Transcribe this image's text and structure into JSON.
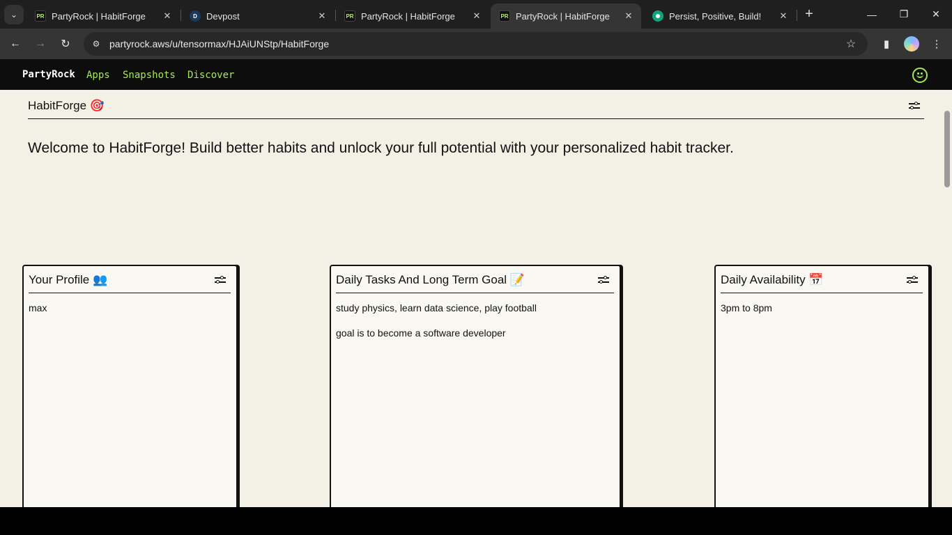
{
  "browser": {
    "tabs": [
      {
        "title": "PartyRock | HabitForge",
        "favicon": "PR",
        "active": false
      },
      {
        "title": "Devpost",
        "favicon": "D",
        "active": false
      },
      {
        "title": "PartyRock | HabitForge",
        "favicon": "PR",
        "active": false
      },
      {
        "title": "PartyRock | HabitForge",
        "favicon": "PR",
        "active": true
      },
      {
        "title": "Persist, Positive, Build!",
        "favicon": "",
        "active": false
      }
    ],
    "url": "partyrock.aws/u/tensormax/HJAiUNStp/HabitForge"
  },
  "app_nav": {
    "brand": "PartyRock",
    "links": [
      "Apps",
      "Snapshots",
      "Discover"
    ],
    "accent_color": "#a6e65a"
  },
  "app": {
    "title": "HabitForge 🎯",
    "welcome": "Welcome to HabitForge! Build better habits and unlock your full potential with your personalized habit tracker."
  },
  "widgets": [
    {
      "title": "Your Profile 👥",
      "lines": [
        "max"
      ]
    },
    {
      "title": "Daily Tasks And Long Term Goal 📝",
      "lines": [
        "study physics, learn data science, play football",
        "goal is to become a software developer"
      ]
    },
    {
      "title": "Daily Availability 📅",
      "lines": [
        "3pm to 8pm"
      ]
    }
  ]
}
